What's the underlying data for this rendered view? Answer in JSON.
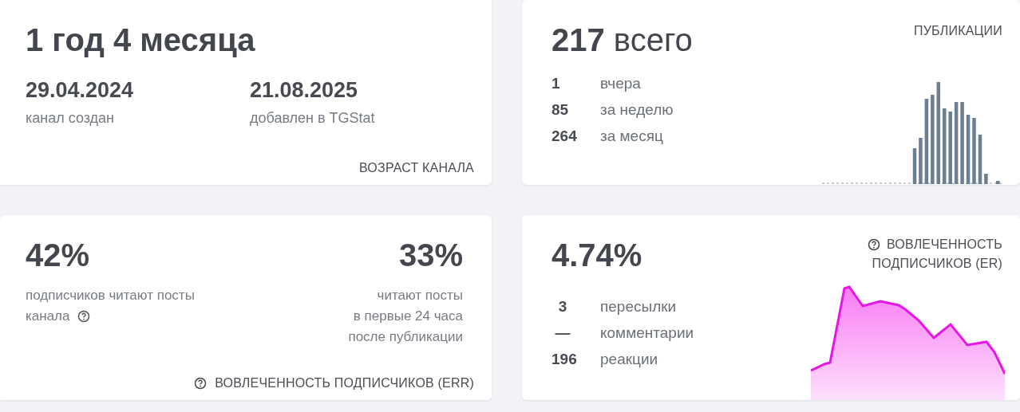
{
  "age_card": {
    "duration": "1 год 4 месяца",
    "dates": [
      {
        "value": "29.04.2024",
        "label": "канал создан"
      },
      {
        "value": "21.08.2025",
        "label": "добавлен в TGStat"
      }
    ],
    "caption": "ВОЗРАСТ КАНАЛА"
  },
  "posts_card": {
    "total": "**217** всего",
    "caption": "ПУБЛИКАЦИИ",
    "stats": [
      {
        "value": "1",
        "label": "вчера"
      },
      {
        "value": "85",
        "label": "за неделю"
      },
      {
        "value": "264",
        "label": "за месяц"
      }
    ]
  },
  "reach_card": {
    "left": {
      "value": "42%",
      "lines": [
        "подписчиков читают посты",
        "канала"
      ]
    },
    "right": {
      "value": "33%",
      "lines": [
        "читают посты",
        "в первые 24 часа",
        "после публикации"
      ]
    },
    "caption": "ВОВЛЕЧЕННОСТЬ ПОДПИСЧИКОВ (ERR)"
  },
  "er_card": {
    "value": "4.74%",
    "caption_lines": [
      "ВОВЛЕЧЕННОСТЬ",
      "ПОДПИСЧИКОВ (ER)"
    ],
    "stats": [
      {
        "value": "3",
        "label": "пересылки"
      },
      {
        "value": "—",
        "label": "комментарии"
      },
      {
        "value": "196",
        "label": "реакции"
      }
    ]
  }
}
